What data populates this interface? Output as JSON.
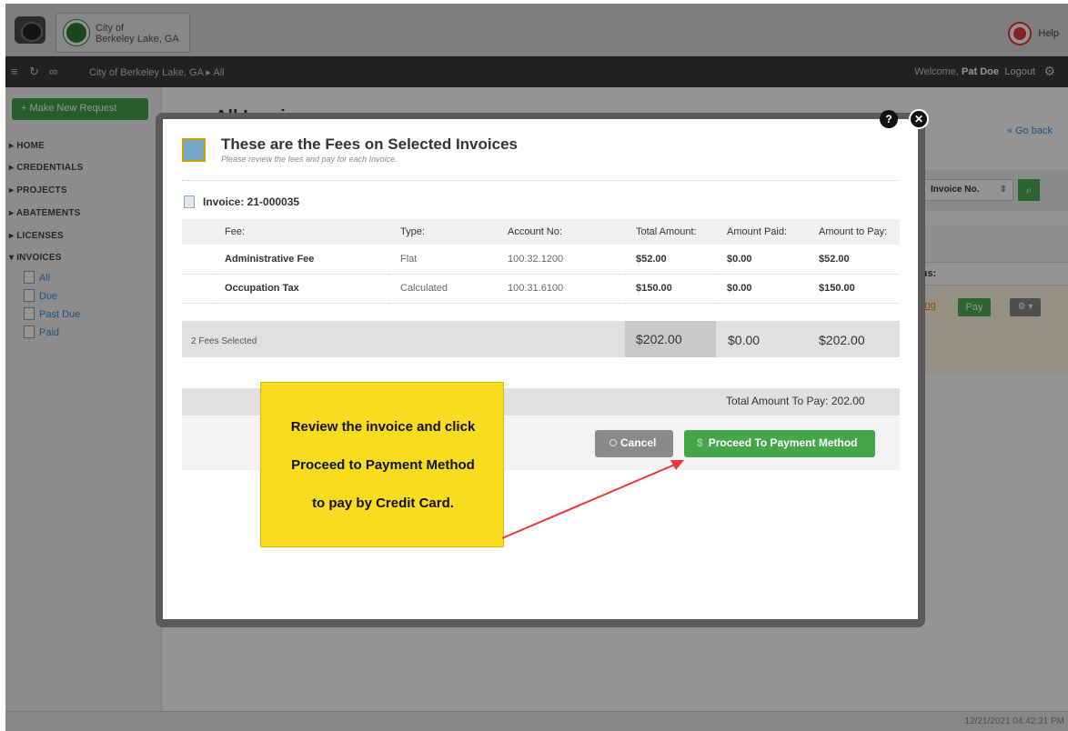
{
  "header": {
    "org_line1": "City of",
    "org_line2": "Berkeley Lake, GA",
    "help_label": "Help"
  },
  "navbar": {
    "breadcrumb": "City of Berkeley Lake, GA ▸ All",
    "welcome_prefix": "Welcome, ",
    "user_name": "Pat Doe",
    "logout_label": "Logout"
  },
  "sidebar": {
    "new_request_label": "+ Make New Request",
    "items": [
      "HOME",
      "CREDENTIALS",
      "PROJECTS",
      "ABATEMENTS",
      "LICENSES",
      "INVOICES"
    ],
    "invoice_subitems": [
      "All",
      "Due",
      "Past Due",
      "Paid"
    ]
  },
  "page": {
    "title": "All Invoices",
    "go_back_label": "Go back",
    "filter_select": "Invoice No.",
    "table_header_fragment": "tus:",
    "status_fragment": "ding",
    "pay_label": "Pay"
  },
  "modal": {
    "title": "These are the Fees on Selected Invoices",
    "subtitle": "Please review the fees and pay for each Invoice.",
    "invoice_label": "Invoice: 21-000035",
    "columns": [
      "Fee:",
      "Type:",
      "Account No:",
      "Total Amount:",
      "Amount Paid:",
      "Amount to Pay:"
    ],
    "rows": [
      {
        "fee": "Administrative Fee",
        "type": "Flat",
        "account": "100.32.1200",
        "total": "$52.00",
        "paid": "$0.00",
        "to_pay": "$52.00"
      },
      {
        "fee": "Occupation Tax",
        "type": "Calculated",
        "account": "100.31.6100",
        "total": "$150.00",
        "paid": "$0.00",
        "to_pay": "$150.00"
      }
    ],
    "summary": {
      "selected": "2 Fees Selected",
      "total": "$202.00",
      "paid": "$0.00",
      "to_pay": "$202.00"
    },
    "total_to_pay": "Total Amount To Pay: 202.00",
    "cancel_label": "Cancel",
    "proceed_label": "Proceed To Payment Method"
  },
  "callout": {
    "line1": "Review the invoice and click",
    "line2": "Proceed to Payment Method",
    "line3": "to pay by Credit Card."
  },
  "footer": {
    "timestamp": "12/21/2021 04:42:31 PM"
  },
  "colors": {
    "accent_green": "#46a549",
    "callout_yellow": "#f7dc1f",
    "arrow_red": "#e53935"
  }
}
